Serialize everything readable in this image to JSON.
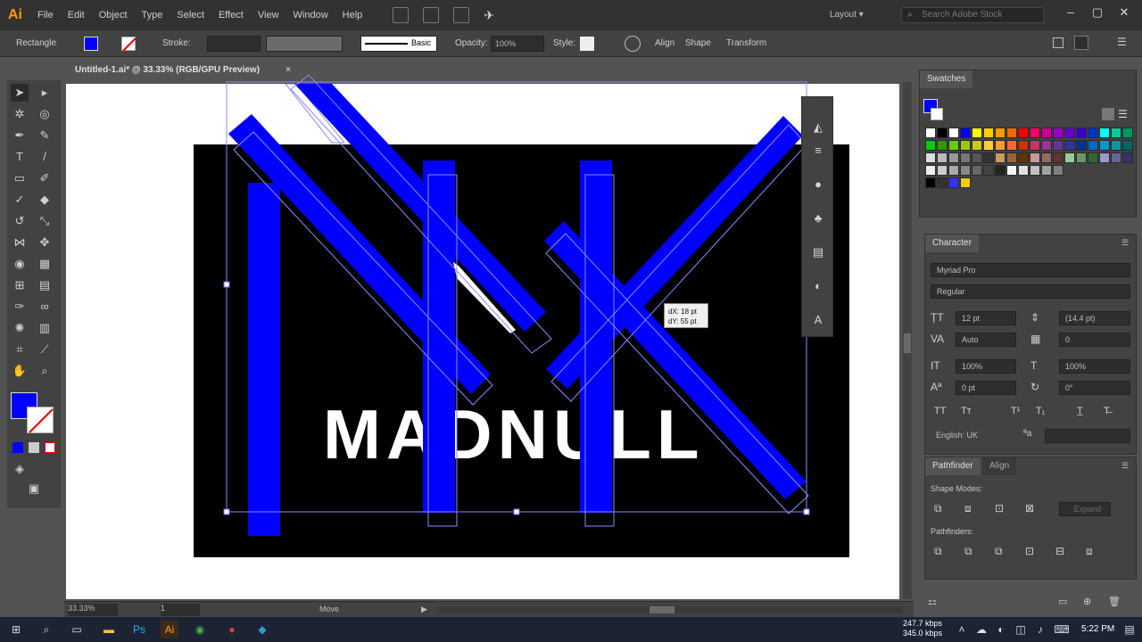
{
  "app": {
    "logo": "Ai",
    "menus": [
      "File",
      "Edit",
      "Object",
      "Type",
      "Select",
      "Effect",
      "View",
      "Window",
      "Help"
    ],
    "layout_label": "Layout",
    "search_placeholder": "Search Adobe Stock"
  },
  "control_bar": {
    "selection_type": "Rectangle",
    "fill_color": "#0000ff",
    "stroke_label": "Stroke:",
    "brush_label": "Basic",
    "opacity_label": "Opacity:",
    "opacity_value": "100%",
    "style_label": "Style:",
    "align_label": "Align",
    "shape_label": "Shape",
    "transform_label": "Transform"
  },
  "document": {
    "tab_title": "Untitled-1.ai* @ 33.33% (RGB/GPU Preview)",
    "close": "×"
  },
  "canvas": {
    "brand_text": "MADNULL",
    "tooltip_dx": "dX: 18 pt",
    "tooltip_dy": "dY: 55 pt",
    "shape_color": "#0000ff"
  },
  "swatches_panel": {
    "title": "Swatches"
  },
  "character_panel": {
    "title": "Character",
    "font_family": "Myriad Pro",
    "font_style": "Regular",
    "font_size": "12 pt",
    "leading": "(14.4 pt)",
    "kerning": "Auto",
    "tracking": "0",
    "vscale": "100%",
    "hscale": "100%",
    "baseline": "0 pt",
    "rotation": "0°",
    "language": "English: UK"
  },
  "pathfinder_panel": {
    "title": "Pathfinder",
    "tab2": "Align",
    "shape_modes_label": "Shape Modes:",
    "expand_label": "Expand",
    "pathfinders_label": "Pathfinders:"
  },
  "status_bar": {
    "zoom": "33.33%",
    "artboard_num": "1",
    "tool_label": "Move"
  },
  "taskbar": {
    "net_up": "247.7 kbps",
    "net_down": "345.0 kbps",
    "time": "5:22 PM"
  }
}
